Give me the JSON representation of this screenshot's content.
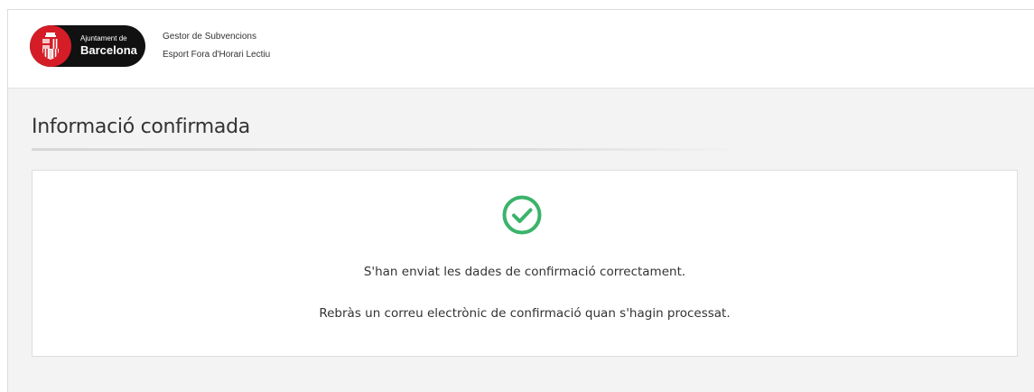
{
  "header": {
    "logo": {
      "line1": "Ajuntament de",
      "line2": "Barcelona"
    },
    "app_title": "Gestor de Subvencions",
    "app_subtitle": "Esport Fora d'Horari Lectiu"
  },
  "main": {
    "title": "Informació confirmada",
    "success_icon": "check-circle-icon",
    "message_sent": "S'han enviat les dades de confirmació correctament.",
    "message_email": "Rebràs un correu electrònic de confirmació quan s'hagin processat."
  },
  "colors": {
    "brand_red": "#d51d27",
    "logo_background": "#111111",
    "success_green": "#3bb36b"
  }
}
